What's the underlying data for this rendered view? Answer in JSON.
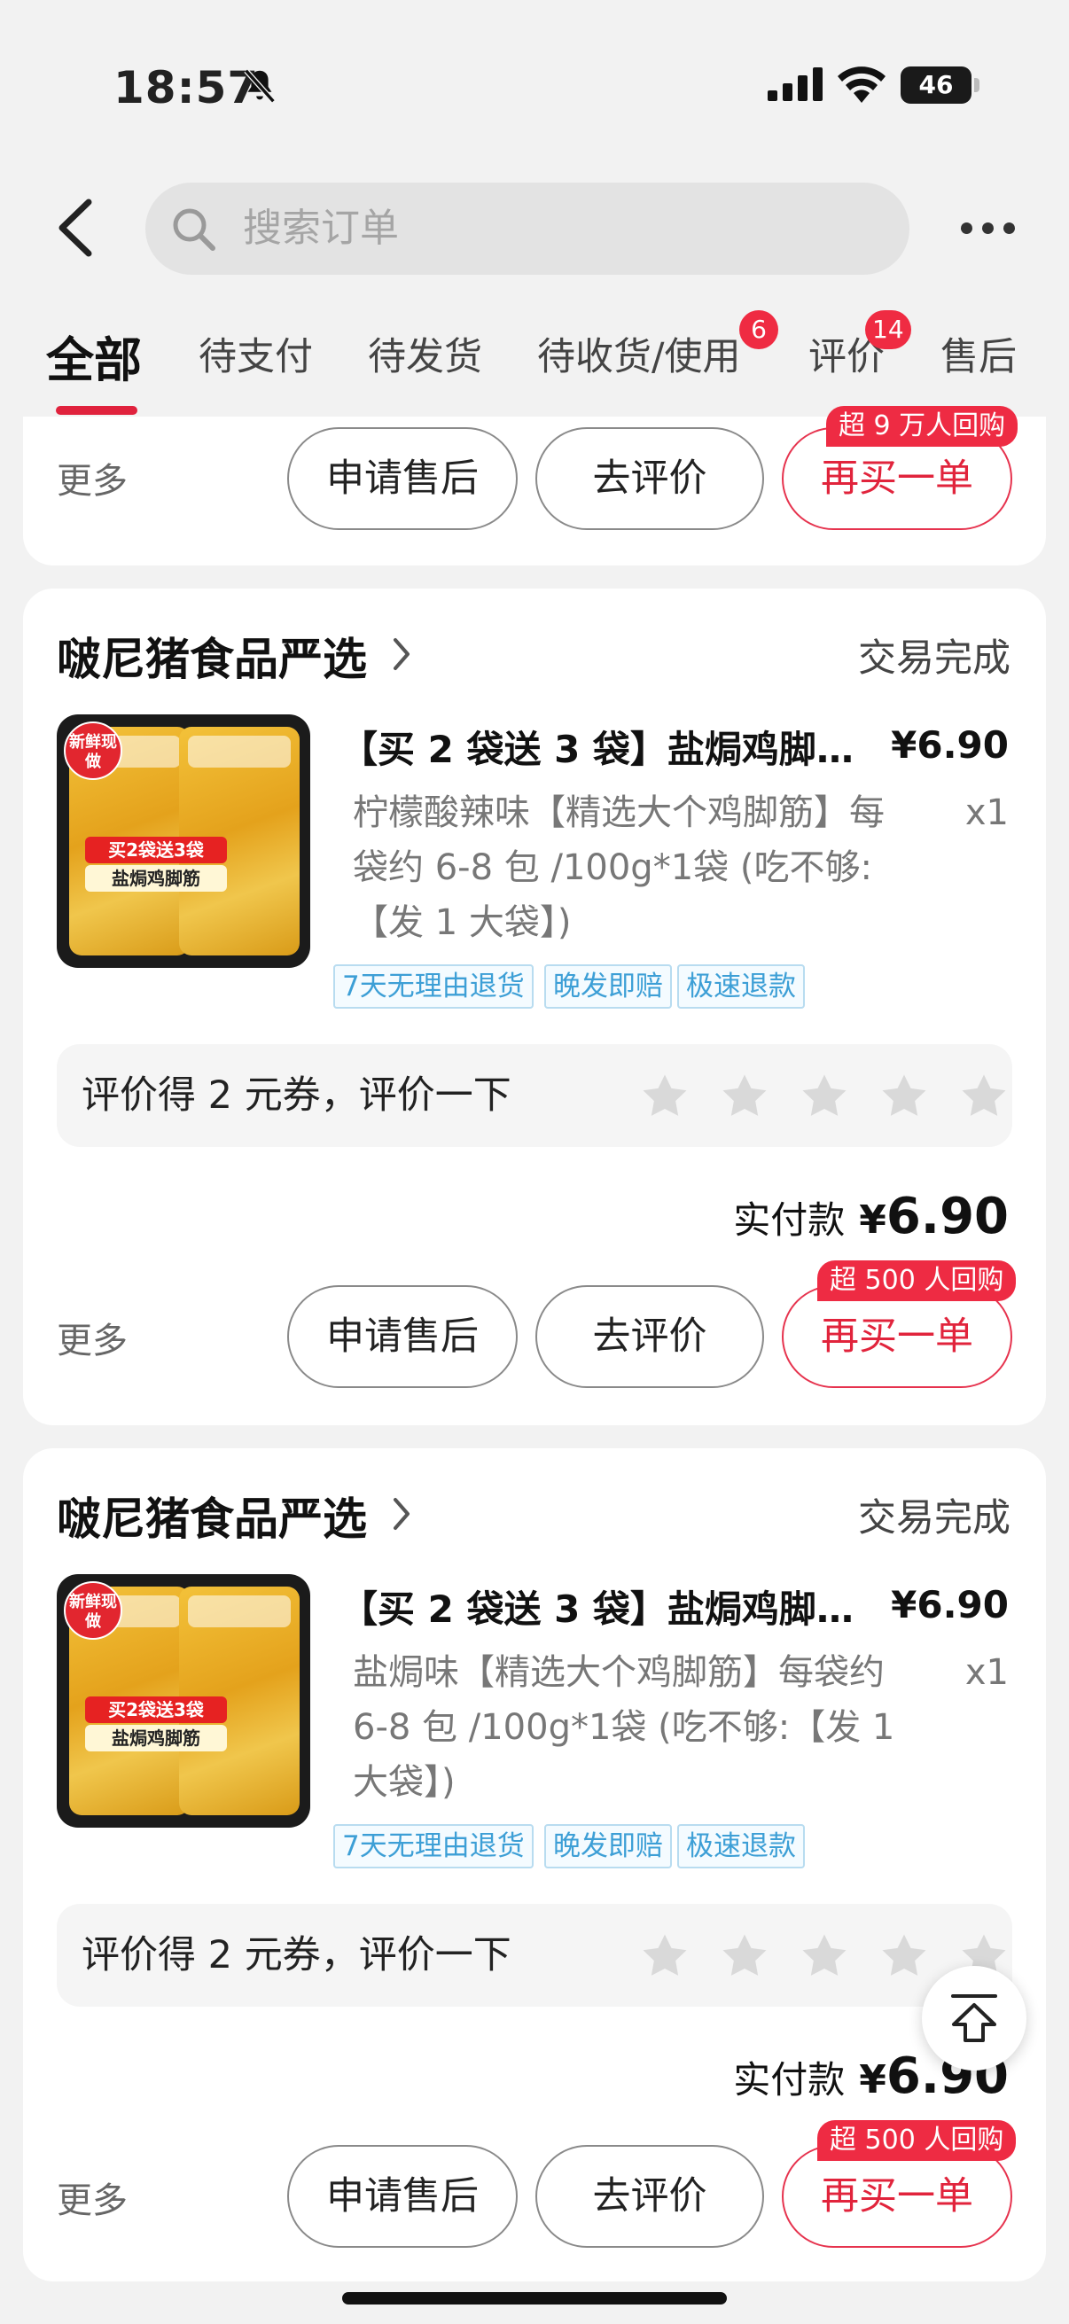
{
  "status_bar": {
    "time": "18:57",
    "battery": "46"
  },
  "search": {
    "placeholder": "搜索订单"
  },
  "tabs": [
    {
      "label": "全部",
      "badge": ""
    },
    {
      "label": "待支付",
      "badge": ""
    },
    {
      "label": "待发货",
      "badge": ""
    },
    {
      "label": "待收货/使用",
      "badge": "6"
    },
    {
      "label": "评价",
      "badge": "14"
    },
    {
      "label": "售后",
      "badge": ""
    }
  ],
  "top_card": {
    "more": "更多",
    "after_sale": "申请售后",
    "review": "去评价",
    "rebuy": "再买一单",
    "rebuy_tag": "超 9 万人回购"
  },
  "orders": [
    {
      "shop": "啵尼猪食品严选",
      "status": "交易完成",
      "thumb": {
        "fresh": "新鲜现做",
        "promo": "买2袋送3袋",
        "label": "盐焗鸡脚筋"
      },
      "title": "【买 2 袋送 3 袋】盐焗鸡脚筋…",
      "price": "¥6.90",
      "spec": "柠檬酸辣味【精选大个鸡脚筋】每袋约 6-8 包 /100g*1袋 (吃不够:【发 1 大袋】)",
      "qty": "x1",
      "service_tags": [
        "7天无理由退货",
        "晚发即赔",
        "极速退款"
      ],
      "review_prompt": "评价得 2 元券，评价一下",
      "rating": 0,
      "paid_label": "实付款",
      "paid_currency": "¥",
      "paid_amount": "6.90",
      "more": "更多",
      "after_sale": "申请售后",
      "review": "去评价",
      "rebuy": "再买一单",
      "rebuy_tag": "超 500 人回购"
    },
    {
      "shop": "啵尼猪食品严选",
      "status": "交易完成",
      "thumb": {
        "fresh": "新鲜现做",
        "promo": "买2袋送3袋",
        "label": "盐焗鸡脚筋"
      },
      "title": "【买 2 袋送 3 袋】盐焗鸡脚筋…",
      "price": "¥6.90",
      "spec": "盐焗味【精选大个鸡脚筋】每袋约 6-8 包 /100g*1袋 (吃不够:【发 1 大袋】)",
      "qty": "x1",
      "service_tags": [
        "7天无理由退货",
        "晚发即赔",
        "极速退款"
      ],
      "review_prompt": "评价得 2 元券，评价一下",
      "rating": 0,
      "paid_label": "实付款",
      "paid_currency": "¥",
      "paid_amount": "6.90",
      "more": "更多",
      "after_sale": "申请售后",
      "review": "去评价",
      "rebuy": "再买一单",
      "rebuy_tag": "超 500 人回购"
    }
  ],
  "colors": {
    "accent": "#e1243c",
    "service_tag": "#3d9fd6",
    "background": "#f2f2f2"
  }
}
